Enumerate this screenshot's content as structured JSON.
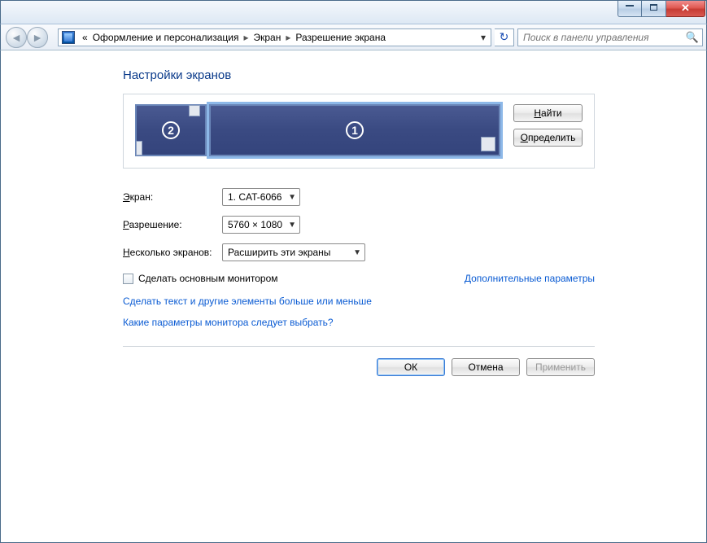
{
  "titlebar": {
    "min_tip": "Свернуть",
    "max_tip": "Развернуть",
    "close_tip": "Закрыть"
  },
  "nav": {
    "chev": "«",
    "crumb1": "Оформление и персонализация",
    "crumb2": "Экран",
    "crumb3": "Разрешение экрана",
    "search_placeholder": "Поиск в панели управления"
  },
  "page": {
    "title": "Настройки экранов"
  },
  "arrange": {
    "find_label": "Найти",
    "identify_label": "Определить",
    "mon1": "1",
    "mon2": "2"
  },
  "labels": {
    "display": "Экран:",
    "resolution": "Разрешение:",
    "multi": "Несколько экранов:"
  },
  "values": {
    "display": "1. CAT-6066",
    "resolution": "5760 × 1080",
    "multi": "Расширить эти экраны"
  },
  "checkbox": {
    "primary_label": "Сделать основным монитором"
  },
  "links": {
    "advanced": "Дополнительные параметры",
    "textsize": "Сделать текст и другие элементы больше или меньше",
    "which": "Какие параметры монитора следует выбрать?"
  },
  "buttons": {
    "ok": "ОК",
    "cancel": "Отмена",
    "apply": "Применить"
  }
}
